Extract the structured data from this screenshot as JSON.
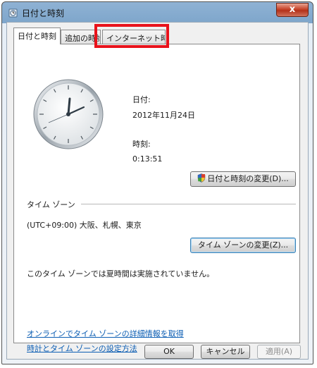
{
  "window": {
    "title": "日付と時刻",
    "close_label": "x",
    "title_icon": "clock-icon"
  },
  "tabs": [
    {
      "label": "日付と時刻",
      "active": true
    },
    {
      "label": "追加の時計",
      "active": false
    },
    {
      "label": "インターネット時刻",
      "active": false,
      "highlighted": true
    }
  ],
  "date": {
    "label": "日付:",
    "value": "2012年11月24日"
  },
  "time": {
    "label": "時刻:",
    "value": "0:13:51"
  },
  "change_datetime_button": {
    "label": "日付と時刻の変更(D)..."
  },
  "timezone": {
    "section_label": "タイム ゾーン",
    "value": "(UTC+09:00) 大阪、札幌、東京",
    "change_button": "タイム ゾーンの変更(Z)...",
    "dst_note": "このタイム ゾーンでは夏時間は実施されていません。"
  },
  "links": {
    "online_info": "オンラインでタイム ゾーンの詳細情報を取得",
    "how_to": "時計とタイム ゾーンの設定方法"
  },
  "footer": {
    "ok": "OK",
    "cancel": "キャンセル",
    "apply": "適用(A)"
  },
  "colors": {
    "highlight_box": "#e8121b",
    "link": "#0b5db3"
  }
}
